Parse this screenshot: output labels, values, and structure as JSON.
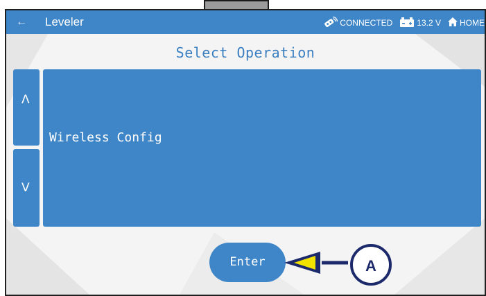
{
  "app_bar": {
    "title": "Leveler",
    "back_icon": "arrow-left",
    "connection_status": "CONNECTED",
    "voltage": "13.2 V",
    "home_label": "HOME"
  },
  "main": {
    "heading": "Select Operation",
    "scroll_up_label": "Λ",
    "scroll_down_label": "V",
    "selected_item": "Wireless Config",
    "enter_label": "Enter"
  },
  "callout": {
    "label": "A"
  },
  "colors": {
    "primary": "#3f86c8",
    "heading": "#3b7fc0",
    "callout": "#1c2a6b",
    "callout_arrow": "#f2e200"
  }
}
